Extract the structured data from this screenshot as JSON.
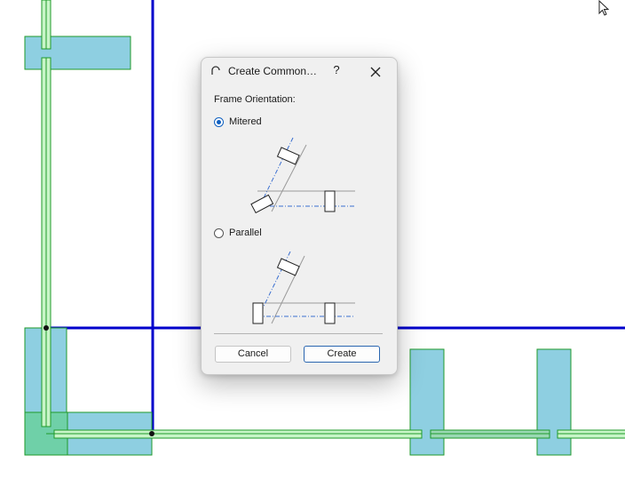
{
  "dialog": {
    "title": "Create Common…",
    "help_label": "?",
    "group_label": "Frame Orientation:",
    "options": [
      {
        "label": "Mitered",
        "selected": true
      },
      {
        "label": "Parallel",
        "selected": false
      }
    ],
    "cancel_label": "Cancel",
    "create_label": "Create"
  },
  "colors": {
    "axis_blue": "#0000cc",
    "column_fill": "#8ecfe1",
    "frame_green": "#1f9a2a",
    "frame_fill": "#c8f5c8",
    "accent": "#1060c0"
  },
  "icons": [
    "app-icon",
    "close-icon",
    "cursor-arrow-icon"
  ]
}
